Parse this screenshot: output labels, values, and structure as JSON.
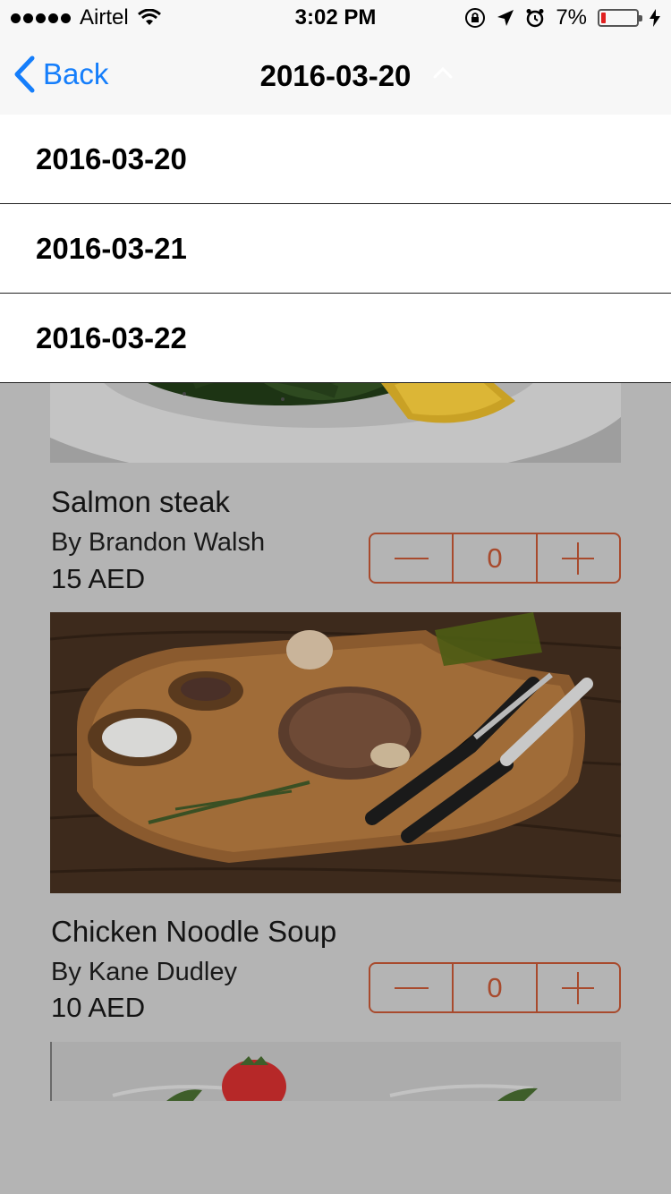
{
  "status_bar": {
    "carrier": "Airtel",
    "time": "3:02 PM",
    "battery_percent": "7%",
    "battery_level": 0.07,
    "icons": [
      "signal-dots-icon",
      "wifi-icon",
      "orientation-lock-icon",
      "location-arrow-icon",
      "alarm-icon",
      "battery-icon",
      "charging-bolt-icon"
    ]
  },
  "nav": {
    "back_label": "Back",
    "title": "2016-03-20",
    "title_icon": "chevron-up-icon",
    "accent_color": "#157efb"
  },
  "dropdown": {
    "options": [
      "2016-03-20",
      "2016-03-21",
      "2016-03-22"
    ]
  },
  "dishes": [
    {
      "name": "Salmon steak",
      "chef": "By Brandon Walsh",
      "price": "15 AED",
      "quantity": "0",
      "image": "salmon-plate-with-spinach-and-lemon"
    },
    {
      "name": "Chicken Noodle Soup",
      "chef": "By Kane Dudley",
      "price": "10 AED",
      "quantity": "0",
      "image": "steak-on-wooden-board-with-fork-and-knife"
    },
    {
      "image": "dessert-with-strawberry"
    }
  ],
  "stepper": {
    "decrement_icon": "minus-icon",
    "increment_icon": "plus-icon",
    "color": "#a84a2d"
  }
}
